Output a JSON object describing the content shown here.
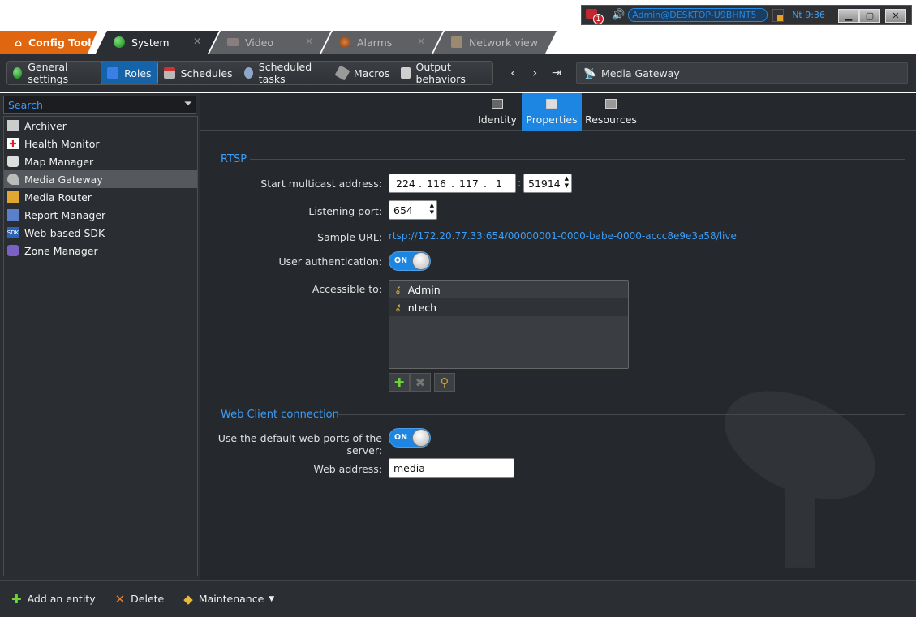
{
  "tabs": {
    "config": "Config Tool",
    "system": "System",
    "video": "Video",
    "alarms": "Alarms",
    "network": "Network view"
  },
  "status": {
    "alert_count": "1",
    "user": "Admin@DESKTOP-U9BHNT5",
    "clock": "Nt 9:36"
  },
  "toolbar": {
    "items": [
      "General settings",
      "Roles",
      "Schedules",
      "Scheduled tasks",
      "Macros",
      "Output behaviors"
    ],
    "active": "Roles",
    "breadcrumb": "Media Gateway"
  },
  "left": {
    "search_placeholder": "Search",
    "entities": [
      "Archiver",
      "Health Monitor",
      "Map Manager",
      "Media Gateway",
      "Media Router",
      "Report Manager",
      "Web-based SDK",
      "Zone Manager"
    ],
    "selected": "Media Gateway"
  },
  "panel_tabs": [
    "Identity",
    "Properties",
    "Resources"
  ],
  "rtsp": {
    "section_title": "RTSP",
    "multicast_label": "Start multicast address:",
    "multicast_octets": [
      "224",
      "116",
      "117",
      "1"
    ],
    "multicast_port": "51914",
    "listening_label": "Listening port:",
    "listening_port": "654",
    "sample_url_label": "Sample URL:",
    "sample_url": "rtsp://172.20.77.33:654/00000001-0000-babe-0000-accc8e9e3a58/live",
    "user_auth_label": "User authentication:",
    "user_auth_state": "ON",
    "accessible_label": "Accessible to:",
    "accessible": [
      "Admin",
      "ntech"
    ]
  },
  "web": {
    "section_title": "Web Client connection",
    "default_ports_label": "Use the default web ports of the server:",
    "default_ports_state": "ON",
    "web_address_label": "Web address:",
    "web_address": "media"
  },
  "bottom": {
    "add": "Add an entity",
    "delete": "Delete",
    "maintenance": "Maintenance"
  },
  "colors": {
    "accent": "#1d86e2",
    "config_tab": "#e0660f",
    "link": "#3b9df5"
  }
}
